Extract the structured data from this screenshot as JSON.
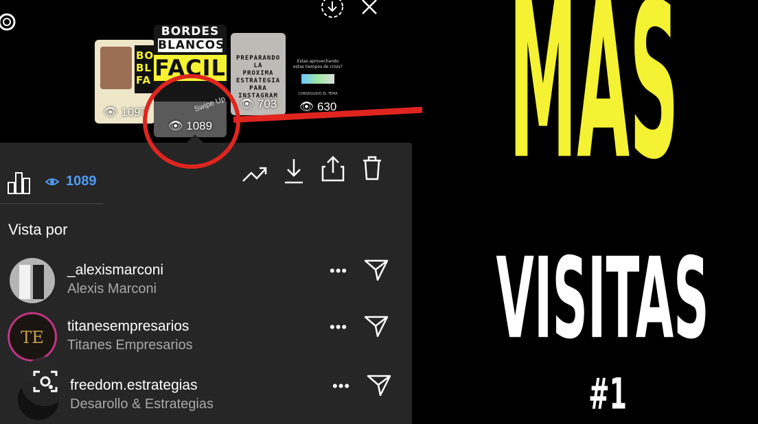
{
  "story": {
    "thumbnails": [
      {
        "title": "BO BL FA",
        "views": "1097"
      },
      {
        "title_line1": "BORDES",
        "title_line2": "BLANCOS",
        "title_line3": "FACIL",
        "sticker": "Swipe Up",
        "views": "1089"
      },
      {
        "title": "PREPARANDO LA PROXIMA ESTRATEGIA PARA INSTAGRAM",
        "views": "703"
      },
      {
        "title": "Estas aprovechando estas tiempos de crisis?",
        "caption": "CONSEGUIDO EL TEMA",
        "views": "630"
      }
    ]
  },
  "stats": {
    "views": "1089"
  },
  "viewers": {
    "heading": "Vista por",
    "items": [
      {
        "username": "_alexismarconi",
        "name": "Alexis Marconi"
      },
      {
        "username": "titanesempresarios",
        "name": "Titanes Empresarios",
        "avatar_text": "TE"
      },
      {
        "username": "freedom.estrategias",
        "name": "Desarollo & Estrategias"
      }
    ],
    "more": "•••"
  },
  "headline": {
    "line1": "MAS",
    "line2": "VISITAS",
    "line3": "#1"
  },
  "colors": {
    "accent_yellow": "#f4f232",
    "highlight_red": "#e0251f",
    "ig_blue": "#4f9cf5"
  },
  "icons": [
    "settings-icon",
    "download-icon",
    "close-icon",
    "insights-icon",
    "eye-icon",
    "trending-icon",
    "save-icon",
    "share-icon",
    "trash-icon",
    "more-icon",
    "send-icon",
    "lens-icon"
  ]
}
